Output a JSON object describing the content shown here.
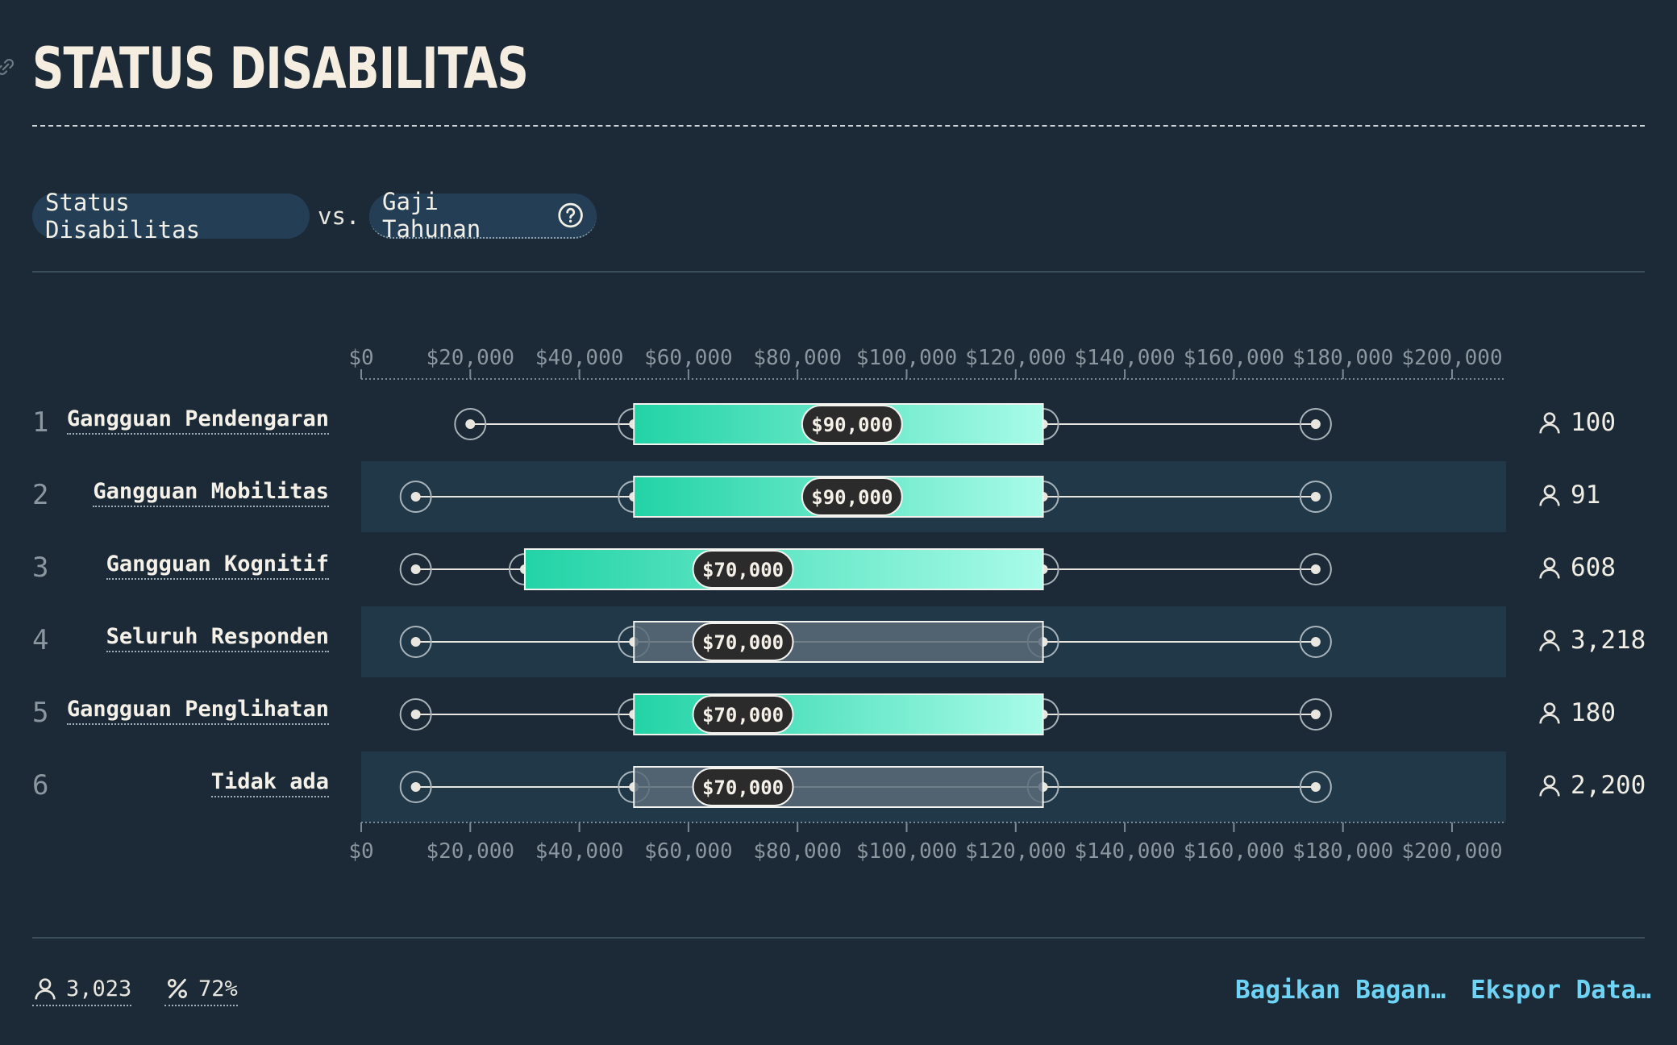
{
  "header": {
    "title": "STATUS DISABILITAS"
  },
  "selector": {
    "left_label": "Status Disabilitas",
    "vs_label": "vs.",
    "right_label": "Gaji Tahunan"
  },
  "chart_data": {
    "type": "box",
    "x_ticks": [
      "$0",
      "$20,000",
      "$40,000",
      "$60,000",
      "$80,000",
      "$100,000",
      "$120,000",
      "$140,000",
      "$160,000",
      "$180,000",
      "$200,000"
    ],
    "xlim": [
      0,
      210000
    ],
    "rows": [
      {
        "rank": "1",
        "label": "Gangguan Pendengaran",
        "min": 20000,
        "q1": 50000,
        "median": 90000,
        "q3": 125000,
        "max": 175000,
        "median_label": "$90,000",
        "count": "100",
        "highlight": true
      },
      {
        "rank": "2",
        "label": "Gangguan Mobilitas",
        "min": 10000,
        "q1": 50000,
        "median": 90000,
        "q3": 125000,
        "max": 175000,
        "median_label": "$90,000",
        "count": "91",
        "highlight": true
      },
      {
        "rank": "3",
        "label": "Gangguan Kognitif",
        "min": 10000,
        "q1": 30000,
        "median": 70000,
        "q3": 125000,
        "max": 175000,
        "median_label": "$70,000",
        "count": "608",
        "highlight": true
      },
      {
        "rank": "4",
        "label": "Seluruh Responden",
        "min": 10000,
        "q1": 50000,
        "median": 70000,
        "q3": 125000,
        "max": 175000,
        "median_label": "$70,000",
        "count": "3,218",
        "highlight": false
      },
      {
        "rank": "5",
        "label": "Gangguan Penglihatan",
        "min": 10000,
        "q1": 50000,
        "median": 70000,
        "q3": 125000,
        "max": 175000,
        "median_label": "$70,000",
        "count": "180",
        "highlight": true
      },
      {
        "rank": "6",
        "label": "Tidak ada",
        "min": 10000,
        "q1": 50000,
        "median": 70000,
        "q3": 125000,
        "max": 175000,
        "median_label": "$70,000",
        "count": "2,200",
        "highlight": false
      }
    ]
  },
  "footer": {
    "respondents": "3,023",
    "percent": "72%",
    "share_label": "Bagikan Bagan…",
    "export_label": "Ekspor Data…"
  },
  "colors": {
    "background": "#1b2a36",
    "stripe": "#203848",
    "box_gradient_start": "#22d3a6",
    "box_gradient_end": "#a8fbe8",
    "box_neutral": "#5a6b78",
    "link": "#6fd3f5"
  },
  "icons": [
    "link-icon",
    "help-circle-icon",
    "person-icon",
    "percent-icon"
  ]
}
